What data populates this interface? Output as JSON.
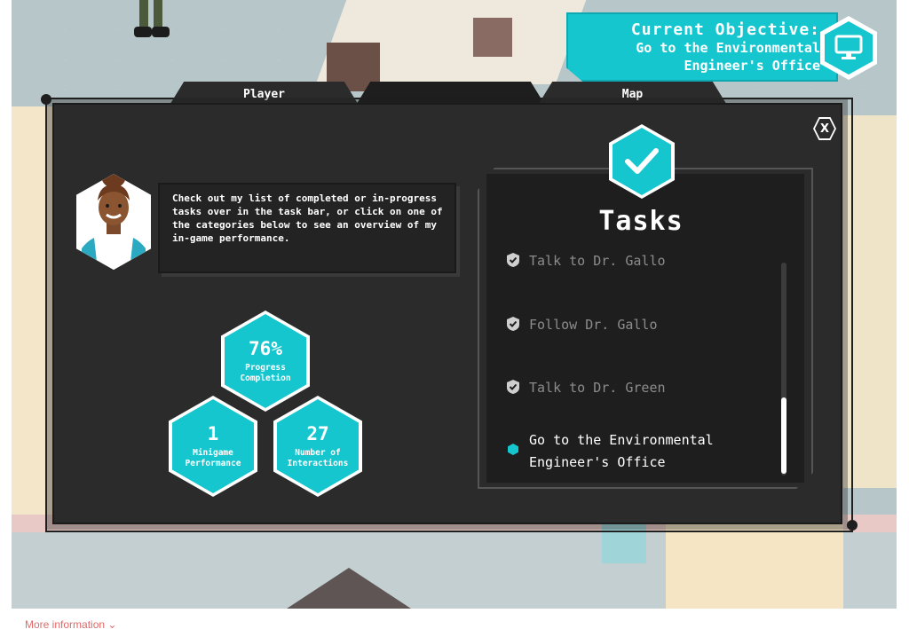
{
  "objective": {
    "title": "Current Objective:",
    "line1": "Go to the Environmental",
    "line2": "Engineer's Office",
    "icon": "computer-monitor-icon"
  },
  "tabs": [
    {
      "label": "Player"
    },
    {
      "label": ""
    },
    {
      "label": "Map"
    }
  ],
  "close_label": "X",
  "speech": "Check out my list of completed or in-progress tasks over in the task bar, or click on one of the categories below to see an overview of my in-game performance.",
  "stats": {
    "progress": {
      "value": "76%",
      "label_line1": "Progress",
      "label_line2": "Completion"
    },
    "minigame": {
      "value": "1",
      "label_line1": "Minigame",
      "label_line2": "Performance"
    },
    "interactions": {
      "value": "27",
      "label_line1": "Number of",
      "label_line2": "Interactions"
    }
  },
  "tasks": {
    "title": "Tasks",
    "items": [
      {
        "text": "Talk to Dr. Gallo",
        "status": "done"
      },
      {
        "text": "Follow Dr. Gallo",
        "status": "done"
      },
      {
        "text": "Talk to Dr. Green",
        "status": "done"
      },
      {
        "text": "Go to the Environmental",
        "text2": "Engineer's Office",
        "status": "current"
      }
    ]
  },
  "footer": {
    "more_info": "More information"
  },
  "colors": {
    "accent": "#15c6cf",
    "panel": "#2b2b2b",
    "link": "#e06a6a"
  }
}
